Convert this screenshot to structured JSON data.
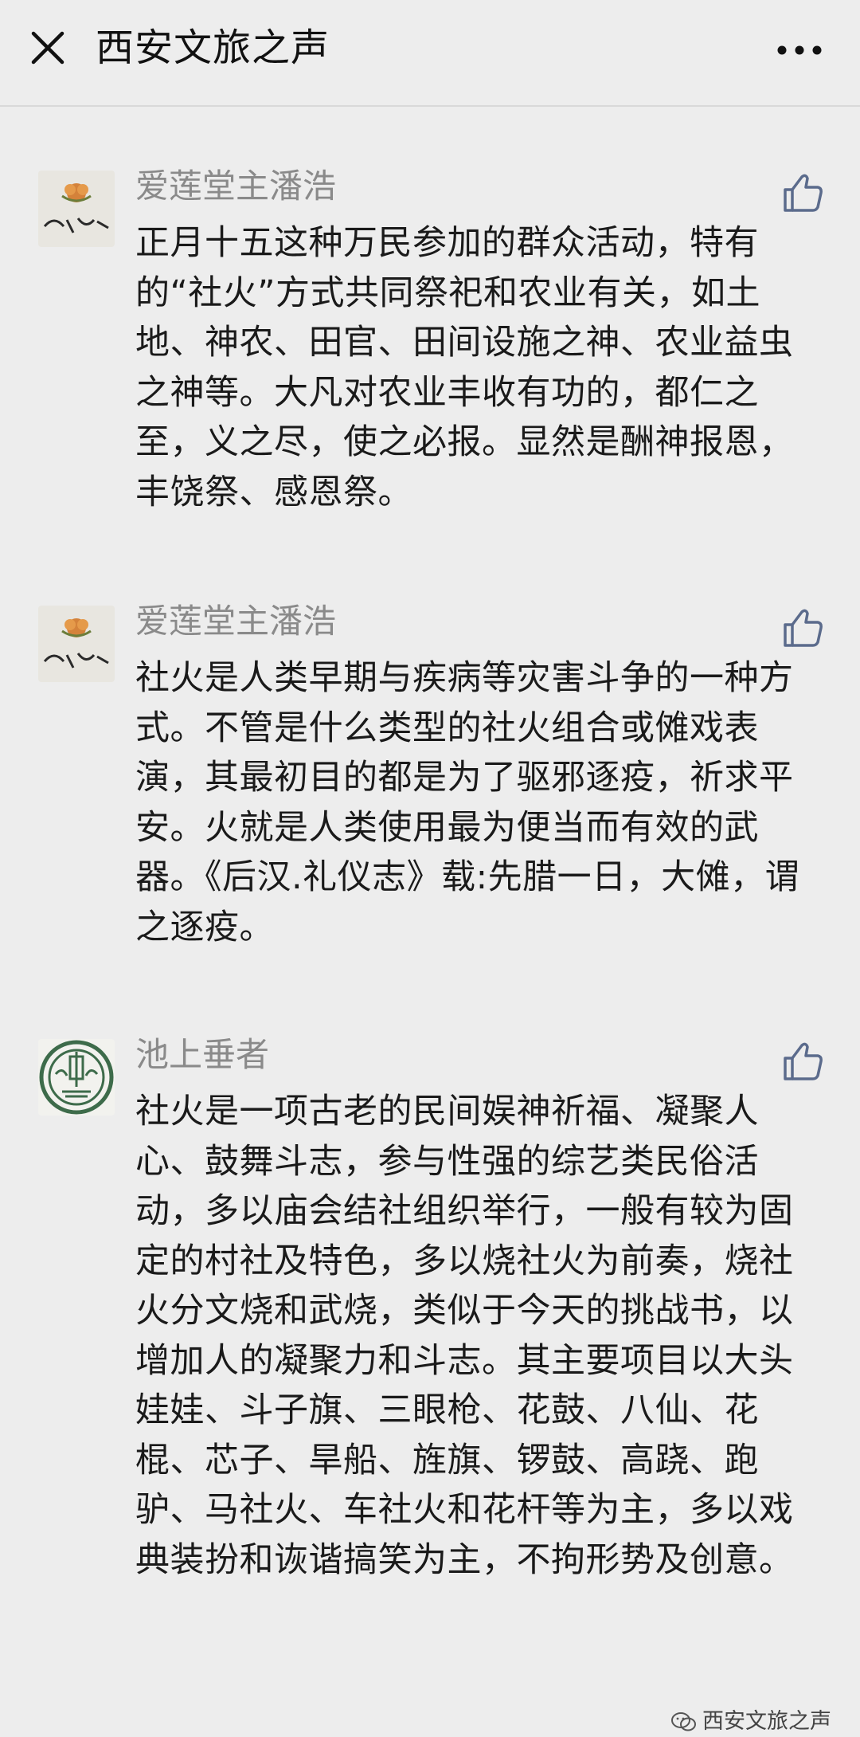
{
  "header": {
    "title": "西安文旅之声"
  },
  "icons": {
    "close": "close-icon",
    "more": "more-icon",
    "like": "thumbs-up-icon",
    "watermark": "wechat-icon"
  },
  "comments": [
    {
      "author": "爱莲堂主潘浩",
      "text": "正月十五这种万民参加的群众活动，特有的“社火”方式共同祭祀和农业有关，如土地、神农、田官、田间设施之神、农业益虫之神等。大凡对农业丰收有功的，都仁之至，义之尽，使之必报。显然是酬神报恩，丰饶祭、感恩祭。"
    },
    {
      "author": "爱莲堂主潘浩",
      "text": "社火是人类早期与疾病等灾害斗争的一种方式。不管是什么类型的社火组合或傩戏表演，其最初目的都是为了驱邪逐疫，祈求平安。火就是人类使用最为便当而有效的武器。《后汉.礼仪志》载:先腊一日，大傩，谓之逐疫。"
    },
    {
      "author": "池上垂者",
      "text": "社火是一项古老的民间娱神祈福、凝聚人心、鼓舞斗志，参与性强的综艺类民俗活动，多以庙会结社组织举行，一般有较为固定的村社及特色，多以烧社火为前奏，烧社火分文烧和武烧，类似于今天的挑战书，以增加人的凝聚力和斗志。其主要项目以大头娃娃、斗子旗、三眼枪、花鼓、八仙、花棍、芯子、旱船、旌旗、锣鼓、高跷、跑驴、马社火、车社火和花杆等为主，多以戏典装扮和诙谐搞笑为主，不拘形势及创意。"
    }
  ],
  "watermark": {
    "text": "西安文旅之声"
  },
  "colors": {
    "background": "#ededed",
    "author": "#8a8a8a",
    "text": "#1a1a1a",
    "accent_like": "#5b6b8c"
  }
}
